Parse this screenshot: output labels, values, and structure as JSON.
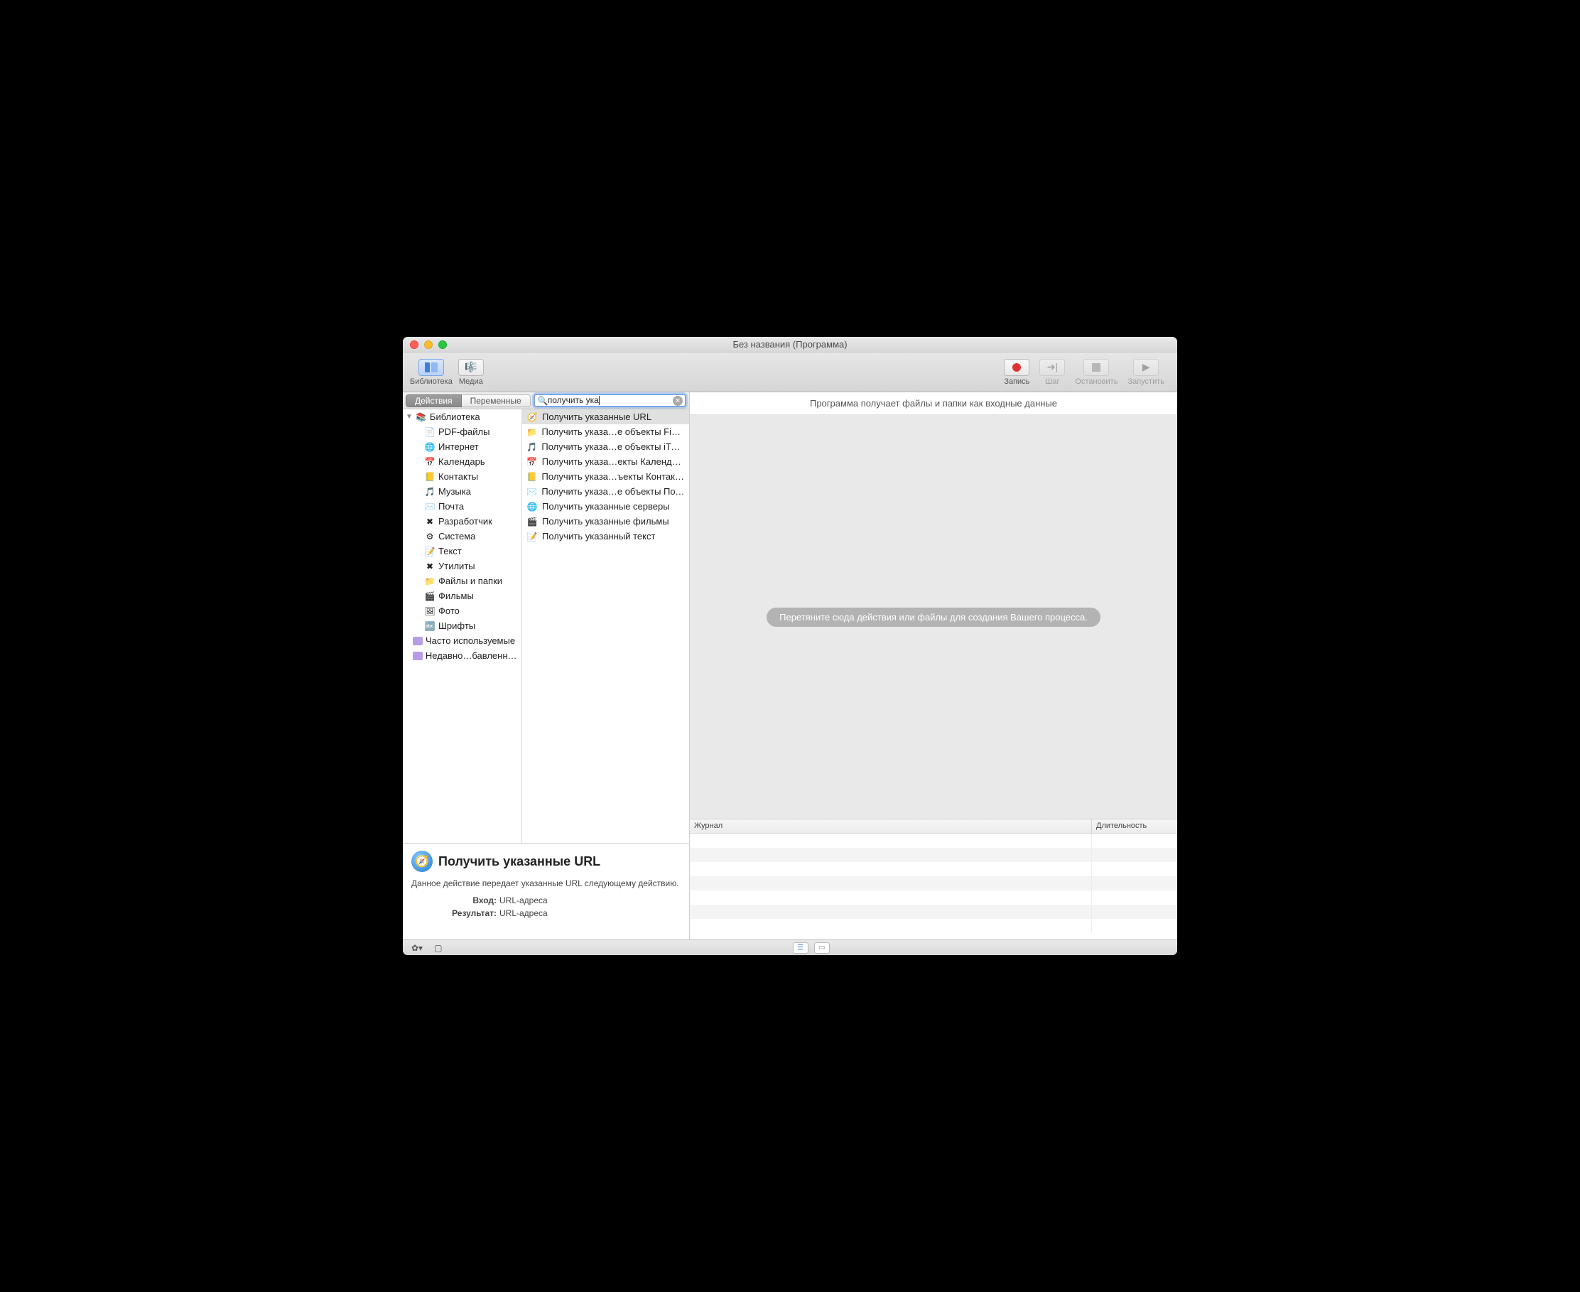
{
  "window": {
    "title": "Без названия (Программа)"
  },
  "toolbar": {
    "library": "Библиотека",
    "media": "Медиа",
    "record": "Запись",
    "step": "Шаг",
    "stop": "Остановить",
    "run": "Запустить"
  },
  "tabs": {
    "actions": "Действия",
    "variables": "Переменные"
  },
  "search": {
    "value": "получить ука"
  },
  "library_label": "Библиотека",
  "categories": [
    {
      "name": "PDF-файлы",
      "icon": "📄"
    },
    {
      "name": "Интернет",
      "icon": "🌐"
    },
    {
      "name": "Календарь",
      "icon": "📅"
    },
    {
      "name": "Контакты",
      "icon": "📒"
    },
    {
      "name": "Музыка",
      "icon": "🎵"
    },
    {
      "name": "Почта",
      "icon": "✉️"
    },
    {
      "name": "Разработчик",
      "icon": "✖"
    },
    {
      "name": "Система",
      "icon": "⚙"
    },
    {
      "name": "Текст",
      "icon": "📝"
    },
    {
      "name": "Утилиты",
      "icon": "✖"
    },
    {
      "name": "Файлы и папки",
      "icon": "📁"
    },
    {
      "name": "Фильмы",
      "icon": "🎬"
    },
    {
      "name": "Фото",
      "icon": "🖼"
    },
    {
      "name": "Шрифты",
      "icon": "🔤"
    }
  ],
  "smart": [
    {
      "name": "Часто используемые"
    },
    {
      "name": "Недавно…бавленные"
    }
  ],
  "actions": [
    {
      "name": "Получить указанные URL",
      "icon": "🧭",
      "selected": true
    },
    {
      "name": "Получить указа…е объекты Finder",
      "icon": "📁"
    },
    {
      "name": "Получить указа…е объекты iTunes",
      "icon": "🎵"
    },
    {
      "name": "Получить указа…екты Календаря",
      "icon": "📅"
    },
    {
      "name": "Получить указа…ъекты Контактов",
      "icon": "📒"
    },
    {
      "name": "Получить указа…е объекты Почты",
      "icon": "✉️"
    },
    {
      "name": "Получить указанные серверы",
      "icon": "🌐"
    },
    {
      "name": "Получить указанные фильмы",
      "icon": "🎬"
    },
    {
      "name": "Получить указанный текст",
      "icon": "📝"
    }
  ],
  "info": {
    "title": "Получить указанные URL",
    "desc": "Данное действие передает указанные URL следующему действию.",
    "input_k": "Вход:",
    "input_v": "URL-адреса",
    "result_k": "Результат:",
    "result_v": "URL-адреса"
  },
  "workflow": {
    "accepts": "Программа получает файлы и папки как входные данные",
    "drop_hint": "Перетяните сюда действия или файлы для создания Вашего процесса."
  },
  "log": {
    "col1": "Журнал",
    "col2": "Длительность"
  }
}
